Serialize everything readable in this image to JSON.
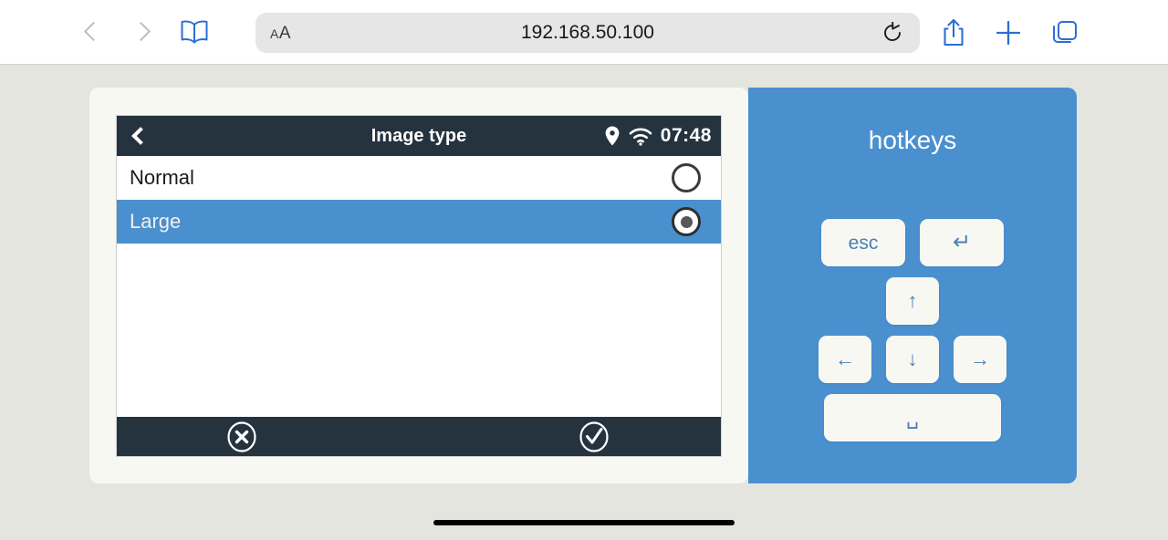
{
  "browser": {
    "back_icon": "chevron-left-icon",
    "forward_icon": "chevron-right-icon",
    "sidebar_icon": "book-sidebar-icon",
    "text_size_label_small": "A",
    "text_size_label_large": "A",
    "url": "192.168.50.100",
    "reload_icon": "reload-icon",
    "share_icon": "share-icon",
    "new_tab_icon": "plus-icon",
    "tabs_icon": "tabs-icon"
  },
  "device": {
    "header": {
      "back_icon": "chevron-left-icon",
      "title": "Image type",
      "location_icon": "location-pin-icon",
      "wifi_icon": "wifi-icon",
      "clock": "07:48"
    },
    "list": [
      {
        "label": "Normal",
        "selected": false
      },
      {
        "label": "Large",
        "selected": true
      }
    ],
    "footer": {
      "cancel_icon": "cancel-circle-icon",
      "confirm_icon": "check-circle-icon"
    }
  },
  "hotkeys": {
    "title": "hotkeys",
    "rows": [
      [
        {
          "name": "esc-key",
          "label": "esc"
        },
        {
          "name": "enter-key",
          "label": "↵"
        }
      ],
      [
        {
          "name": "arrow-up-key",
          "label": "↑"
        }
      ],
      [
        {
          "name": "arrow-left-key",
          "label": "←"
        },
        {
          "name": "arrow-down-key",
          "label": "↓"
        },
        {
          "name": "arrow-right-key",
          "label": "→"
        }
      ],
      [
        {
          "name": "space-key",
          "label": "␣"
        }
      ]
    ]
  },
  "colors": {
    "page_background": "#e5e5df",
    "accent_blue": "#4a90cf",
    "dark_navy": "#25333f",
    "card_cream": "#f8f8f3"
  }
}
